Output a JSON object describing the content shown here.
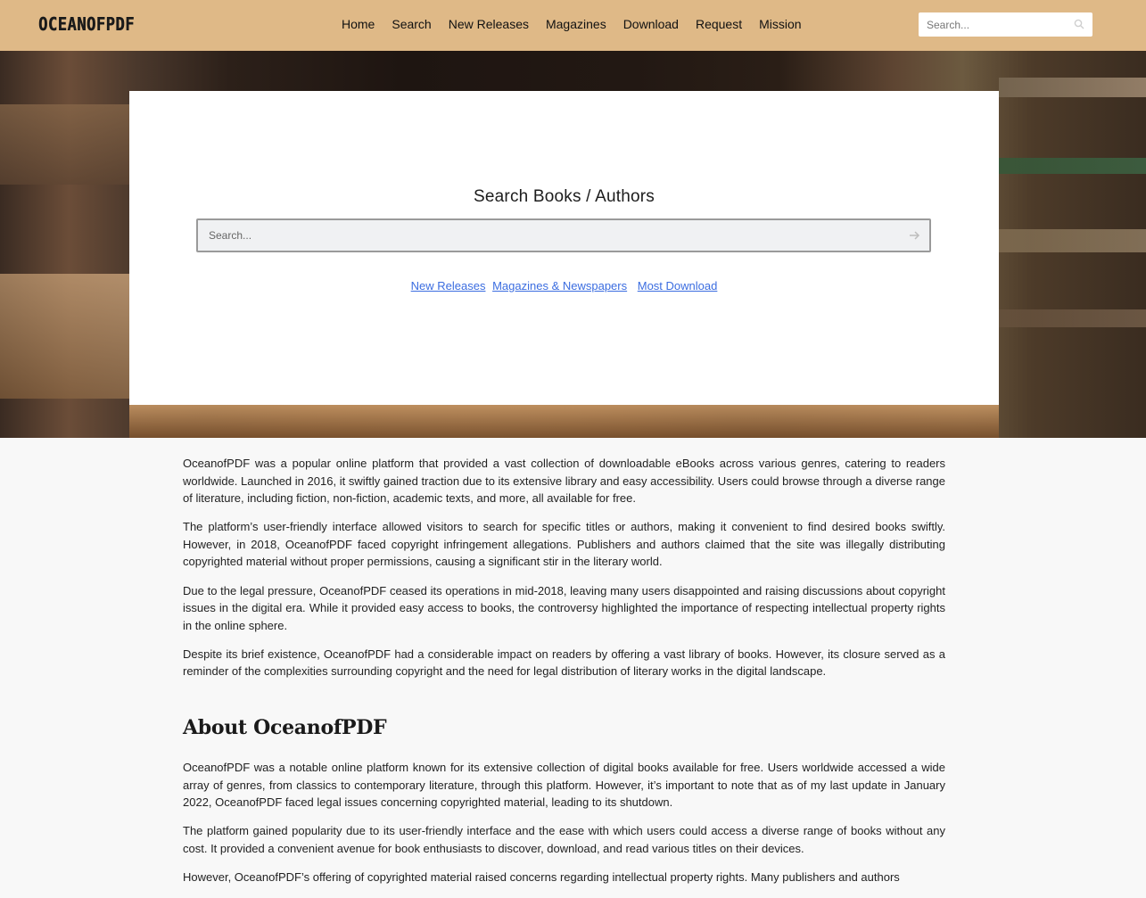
{
  "header": {
    "logo": "OCEANOFPDF",
    "nav": [
      "Home",
      "Search",
      "New Releases",
      "Magazines",
      "Download",
      "Request",
      "Mission"
    ],
    "search_placeholder": "Search..."
  },
  "hero": {
    "title": "Search Books / Authors",
    "search_placeholder": "Search...",
    "links": [
      "New Releases",
      "Magazines & Newspapers",
      "Most Download"
    ]
  },
  "content": {
    "intro": [
      "OceanofPDF was a popular online platform that provided a vast collection of downloadable eBooks across various genres, catering to readers worldwide. Launched in 2016, it swiftly gained traction due to its extensive library and easy accessibility. Users could browse through a diverse range of literature, including fiction, non-fiction, academic texts, and more, all available for free.",
      "The platform’s user-friendly interface allowed visitors to search for specific titles or authors, making it convenient to find desired books swiftly. However, in 2018, OceanofPDF faced copyright infringement allegations. Publishers and authors claimed that the site was illegally distributing copyrighted material without proper permissions, causing a significant stir in the literary world.",
      "Due to the legal pressure, OceanofPDF ceased its operations in mid-2018, leaving many users disappointed and raising discussions about copyright issues in the digital era. While it provided easy access to books, the controversy highlighted the importance of respecting intellectual property rights in the online sphere.",
      "Despite its brief existence, OceanofPDF had a considerable impact on readers by offering a vast library of books. However, its closure served as a reminder of the complexities surrounding copyright and the need for legal distribution of literary works in the digital landscape."
    ],
    "about_heading": "About OceanofPDF",
    "about": [
      "OceanofPDF was a notable online platform known for its extensive collection of digital books available for free. Users worldwide accessed a wide array of genres, from classics to contemporary literature, through this platform. However, it’s important to note that as of my last update in January 2022, OceanofPDF faced legal issues concerning copyrighted material, leading to its shutdown.",
      "The platform gained popularity due to its user-friendly interface and the ease with which users could access a diverse range of books without any cost. It provided a convenient avenue for book enthusiasts to discover, download, and read various titles on their devices.",
      "However, OceanofPDF’s offering of copyrighted material raised concerns regarding intellectual property rights. Many publishers and authors"
    ]
  },
  "colors": {
    "header_bg": "#dfb987",
    "link": "#3b6de0",
    "page_bg": "#f8f8f8"
  }
}
